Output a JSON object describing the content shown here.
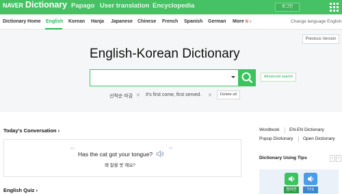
{
  "header": {
    "brand": "NAVER",
    "product": "Dictionary",
    "nav": [
      "Papago",
      "User translation",
      "Encyclopedia"
    ],
    "login_label": "로그인"
  },
  "langbar": {
    "items": [
      "Dictionary Home",
      "English",
      "Korean",
      "Hanja",
      "Japanese",
      "Chinese",
      "French",
      "Spanish",
      "German",
      "More"
    ],
    "more_badge": "N",
    "active": "English",
    "change_language": "Change language English"
  },
  "main": {
    "previous_version": "Previous Version",
    "title": "English-Korean Dictionary",
    "search_value": "",
    "advanced_search": "Advanced search",
    "recent": [
      "선착순 마감",
      "It's first come, first served."
    ],
    "delete_all": "Delete all"
  },
  "conversation": {
    "title": "Today's Conversation",
    "english": "Has the cat got your tongue?",
    "korean": "왜 말을 못 해요?"
  },
  "quiz": {
    "title": "English Quiz"
  },
  "sidebar": {
    "links": [
      "Wordbook",
      "EN-EN Dictionary",
      "Popup Dictionary",
      "Open Dictionary"
    ],
    "tips_title": "Dictionary Using Tips",
    "tip_labels": [
      "원어민",
      "TTS"
    ]
  },
  "colors": {
    "brand_green": "#46c264",
    "search_green": "#3bc35e"
  }
}
